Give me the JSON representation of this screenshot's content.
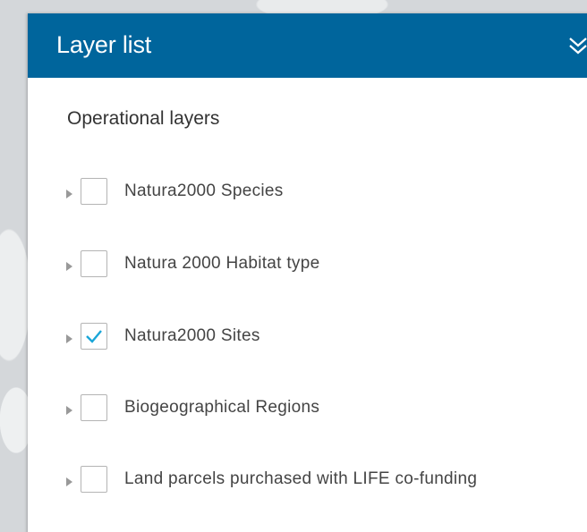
{
  "panel": {
    "title": "Layer list",
    "collapse_icon": "double-chevron-down-icon",
    "header_color": "#00659c"
  },
  "section": {
    "title": "Operational layers"
  },
  "layers": [
    {
      "label": "Natura2000 Species",
      "checked": false
    },
    {
      "label": "Natura 2000 Habitat type",
      "checked": false
    },
    {
      "label": "Natura2000 Sites",
      "checked": true
    },
    {
      "label": "Biogeographical Regions",
      "checked": false
    },
    {
      "label": "Land parcels purchased with LIFE co-funding",
      "checked": false
    }
  ],
  "colors": {
    "checkmark": "#1aa6d8",
    "arrow": "#999999"
  }
}
